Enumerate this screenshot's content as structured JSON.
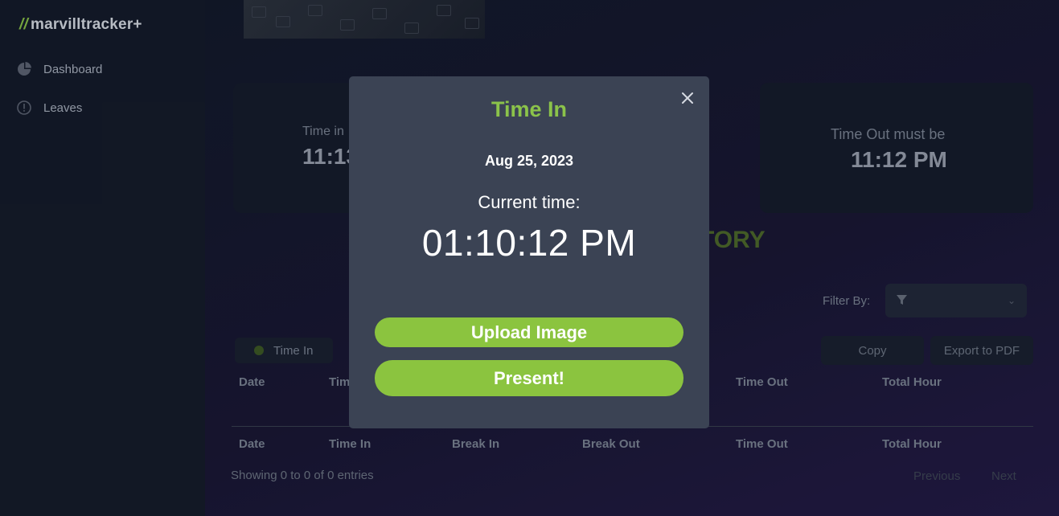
{
  "sidebar": {
    "logo": "marvilltracker+",
    "items": [
      {
        "label": "Dashboard",
        "icon": "pie-chart-icon"
      },
      {
        "label": "Leaves",
        "icon": "alert-circle-icon"
      }
    ]
  },
  "cards": {
    "time_in_label": "Time in",
    "time_in_value": "11:13",
    "time_out_label": "Time Out must be",
    "time_out_value": "11:12 PM"
  },
  "history": {
    "title_visible": "TORY",
    "filter_label": "Filter By:",
    "toggle_label": "Time In",
    "copy_label": "Copy",
    "export_label": "Export to PDF",
    "columns": [
      "Date",
      "Time In",
      "Break In",
      "Break Out",
      "Time Out",
      "Total Hour"
    ],
    "header_visible": [
      "Date",
      "Tim",
      "",
      "",
      "Time Out",
      "Total Hour"
    ],
    "showing": "Showing 0 to 0 of 0 entries",
    "prev_label": "Previous",
    "next_label": "Next"
  },
  "modal": {
    "title": "Time In",
    "date": "Aug 25, 2023",
    "current_time_label": "Current time:",
    "current_time": "01:10:12 PM",
    "upload_label": "Upload Image",
    "present_label": "Present!"
  },
  "colors": {
    "accent_green": "#8bc43f",
    "modal_bg": "#3b4354",
    "page_bg": "#0f1424"
  }
}
